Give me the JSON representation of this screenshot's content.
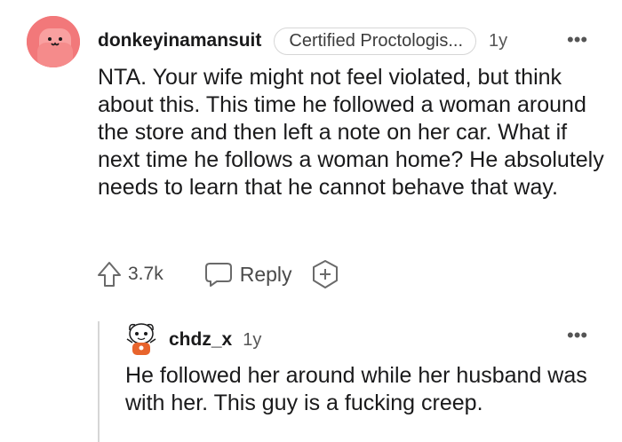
{
  "top_comment": {
    "username": "donkeyinamansuit",
    "flair": "Certified Proctologis...",
    "time": "1y",
    "more_icon": "•••",
    "body": "NTA. Your wife might not feel violated, but think about this. This time he followed a woman around the store and then left a note on her car. What if next time he follows a woman home? He absolutely needs to learn that he cannot behave that way.",
    "upvotes": "3.7k",
    "reply_label": "Reply",
    "icons": {
      "avatar": "snoo-avatar-icon",
      "upvote": "upvote-arrow-icon",
      "reply": "speech-bubble-icon",
      "award": "award-plus-icon"
    },
    "colors": {
      "avatar_bg": "#f2787a"
    }
  },
  "reply_comment": {
    "username": "chdz_x",
    "time": "1y",
    "more_icon": "•••",
    "body": "He followed her around while her husband was with her. This guy is a fucking creep.",
    "icons": {
      "avatar": "snoo-avatar-icon"
    }
  }
}
